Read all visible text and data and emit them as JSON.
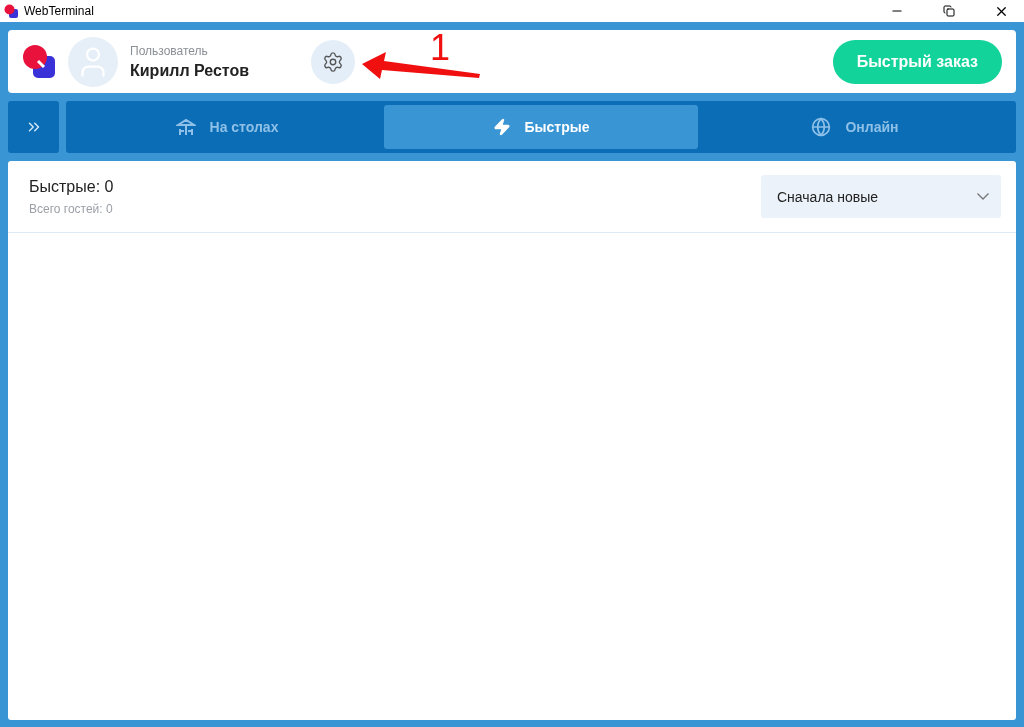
{
  "window": {
    "title": "WebTerminal"
  },
  "user": {
    "caption": "Пользователь",
    "name": "Кирилл Рестов"
  },
  "annotation": {
    "label": "1"
  },
  "quick_order_button": "Быстрый заказ",
  "tabs": [
    {
      "label": "На столах",
      "kind": "tables",
      "selected": false
    },
    {
      "label": "Быстрые",
      "kind": "quick",
      "selected": true
    },
    {
      "label": "Онлайн",
      "kind": "online",
      "selected": false
    }
  ],
  "summary": {
    "title": "Быстрые: 0",
    "subtitle": "Всего гостей: 0"
  },
  "sort": {
    "value": "Сначала новые"
  }
}
